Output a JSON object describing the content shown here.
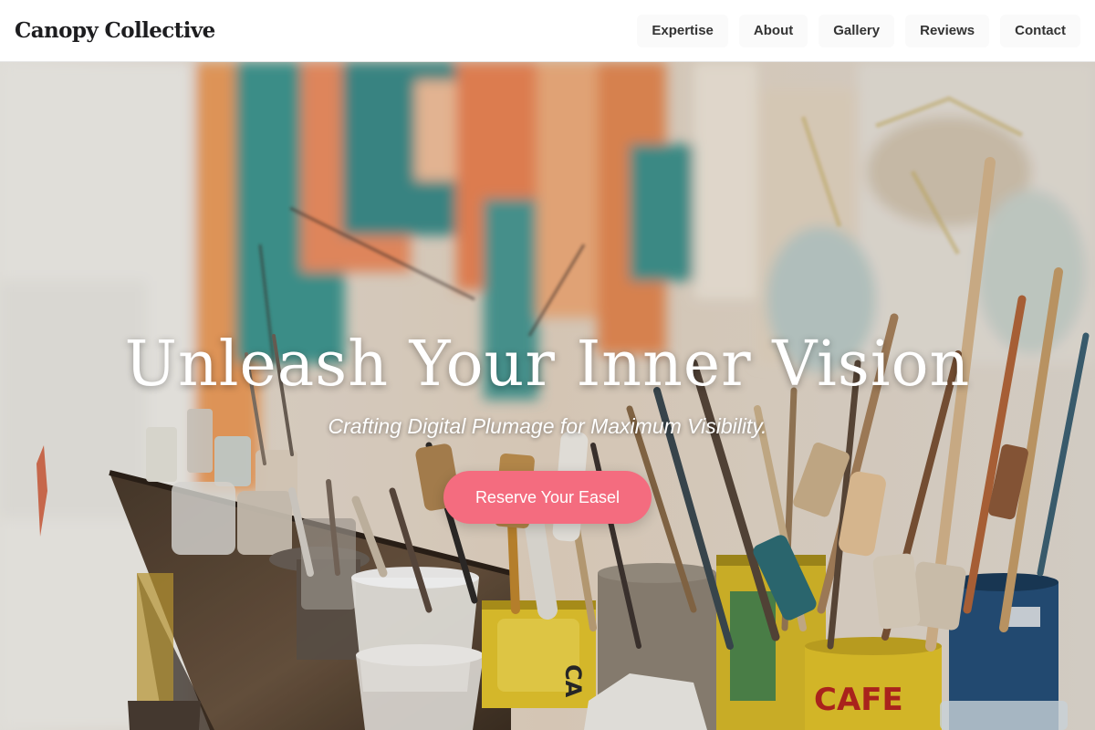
{
  "brand": {
    "name": "Canopy Collective"
  },
  "nav": {
    "items": [
      {
        "label": "Expertise"
      },
      {
        "label": "About"
      },
      {
        "label": "Gallery"
      },
      {
        "label": "Reviews"
      },
      {
        "label": "Contact"
      }
    ]
  },
  "hero": {
    "title": "Unleash Your Inner Vision",
    "subtitle": "Crafting Digital Plumage for Maximum Visibility.",
    "cta_label": "Reserve Your Easel",
    "cta_color": "#f46c7f"
  }
}
